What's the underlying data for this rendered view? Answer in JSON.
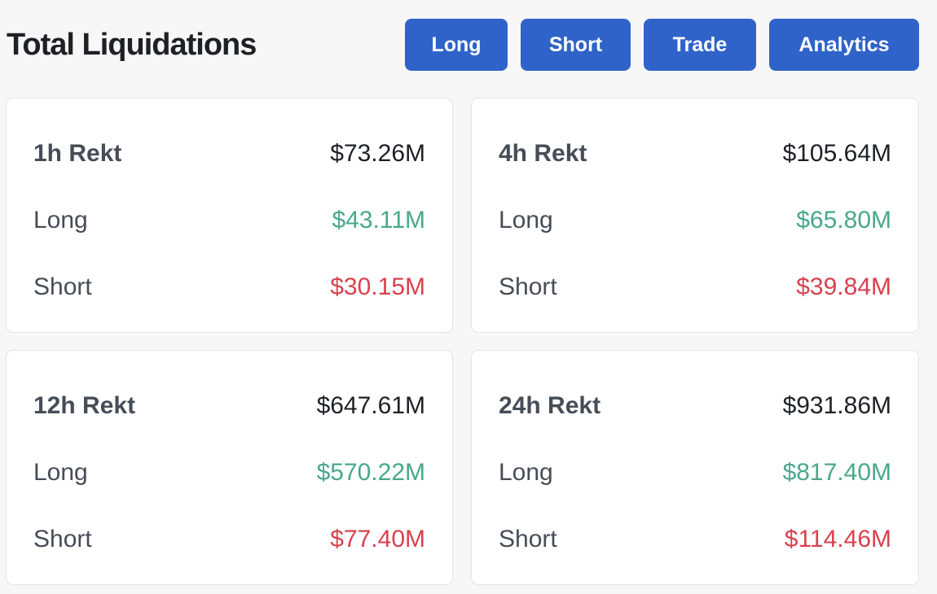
{
  "header": {
    "title": "Total Liquidations",
    "buttons": {
      "long": "Long",
      "short": "Short",
      "trade": "Trade",
      "analytics": "Analytics"
    }
  },
  "colors": {
    "button_bg": "#2f63c9",
    "long_value": "#48a88a",
    "short_value": "#d9414e"
  },
  "cards": [
    {
      "title": "1h Rekt",
      "total": "$73.26M",
      "long_label": "Long",
      "long_value": "$43.11M",
      "short_label": "Short",
      "short_value": "$30.15M"
    },
    {
      "title": "4h Rekt",
      "total": "$105.64M",
      "long_label": "Long",
      "long_value": "$65.80M",
      "short_label": "Short",
      "short_value": "$39.84M"
    },
    {
      "title": "12h Rekt",
      "total": "$647.61M",
      "long_label": "Long",
      "long_value": "$570.22M",
      "short_label": "Short",
      "short_value": "$77.40M"
    },
    {
      "title": "24h Rekt",
      "total": "$931.86M",
      "long_label": "Long",
      "long_value": "$817.40M",
      "short_label": "Short",
      "short_value": "$114.46M"
    }
  ]
}
